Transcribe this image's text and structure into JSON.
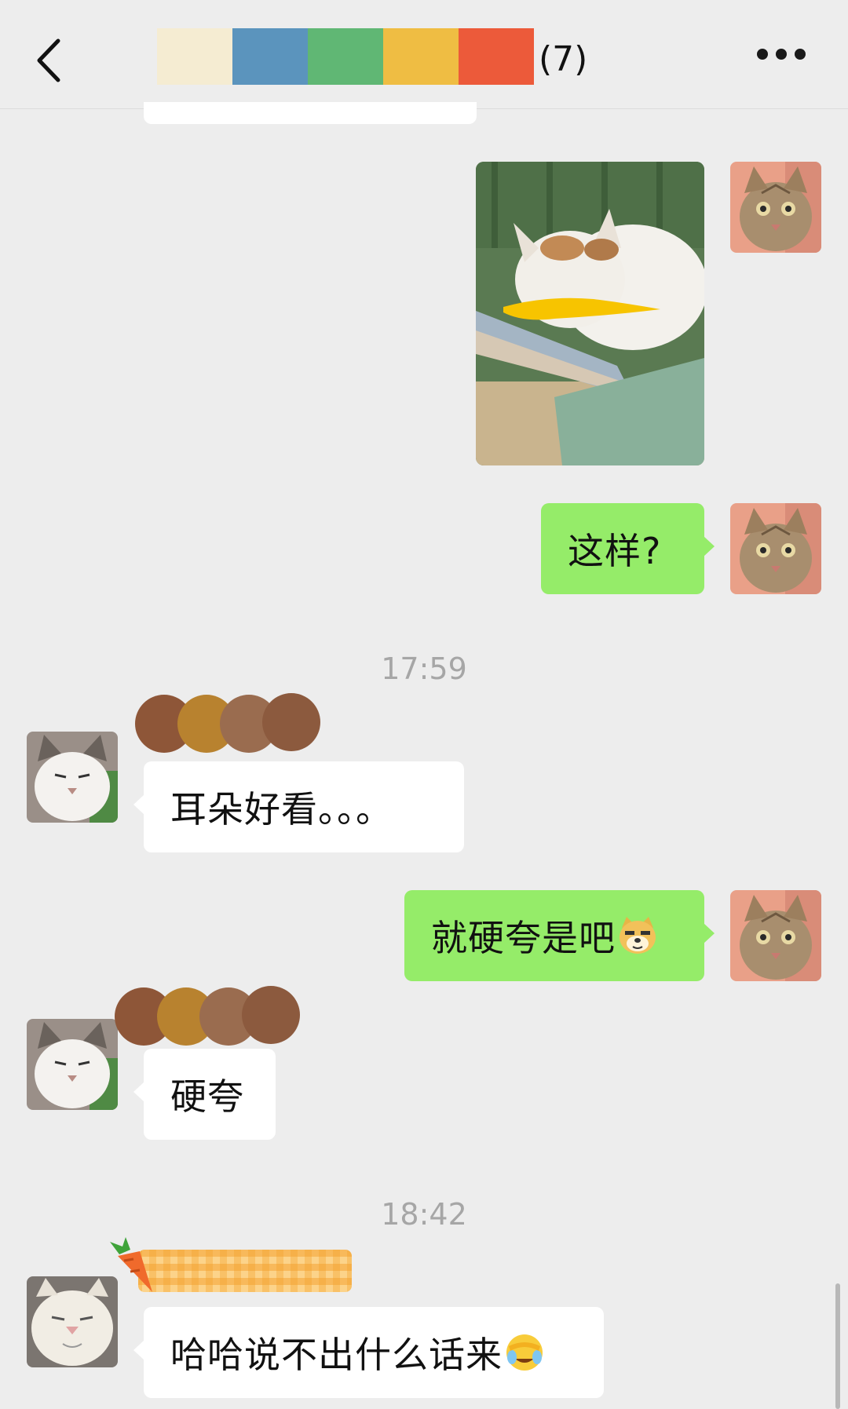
{
  "header": {
    "member_count": "(7)",
    "title_blocks": [
      "#f5ecd2",
      "#5b94bd",
      "#60b774",
      "#efbd43",
      "#ec5a3a"
    ]
  },
  "timestamps": {
    "t1": "17:59",
    "t2": "18:42"
  },
  "messages": [
    {
      "sender": "me",
      "type": "image"
    },
    {
      "sender": "me",
      "type": "text",
      "text": "这样?"
    },
    {
      "sender": "other",
      "type": "text",
      "text": "耳朵好看。。。"
    },
    {
      "sender": "me",
      "type": "text",
      "text": "就硬夸是吧",
      "emoji": "doge-emoji"
    },
    {
      "sender": "other",
      "type": "text",
      "text": "硬夸"
    },
    {
      "sender": "other",
      "type": "text",
      "text": "哈哈说不出什么话来",
      "emoji": "facepalm-emoji"
    }
  ],
  "colors": {
    "background": "#ededed",
    "my_bubble": "#95ec69",
    "other_bubble": "#ffffff",
    "timestamp": "#a6a6a6",
    "nickname_dots": [
      "#8e5638",
      "#b8822f",
      "#9a6c4f",
      "#8c5a3e"
    ]
  }
}
